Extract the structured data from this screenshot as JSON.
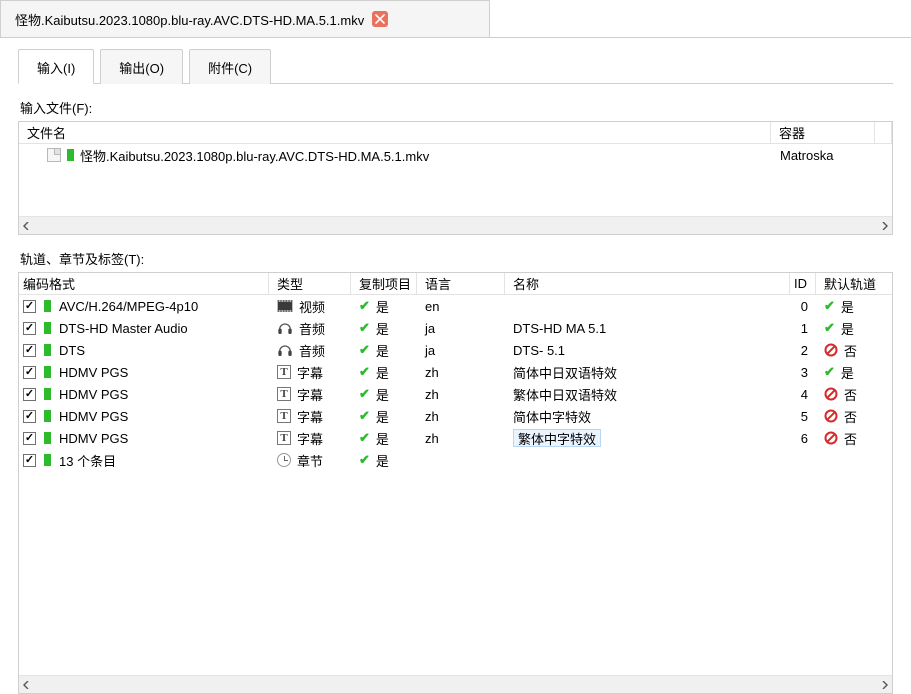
{
  "window_tab": {
    "title": "怪物.Kaibutsu.2023.1080p.blu-ray.AVC.DTS-HD.MA.5.1.mkv"
  },
  "inner_tabs": {
    "input": "输入(I)",
    "output": "输出(O)",
    "attach": "附件(C)"
  },
  "labels": {
    "input_files": "输入文件(F):",
    "tracks": "轨道、章节及标签(T):"
  },
  "file_table": {
    "headers": {
      "name": "文件名",
      "container": "容器"
    },
    "rows": [
      {
        "name": "怪物.Kaibutsu.2023.1080p.blu-ray.AVC.DTS-HD.MA.5.1.mkv",
        "container": "Matroska"
      }
    ]
  },
  "tracks_table": {
    "headers": {
      "codec": "编码格式",
      "type": "类型",
      "copy": "复制项目",
      "lang": "语言",
      "name": "名称",
      "id": "ID",
      "def": "默认轨道"
    },
    "type_labels": {
      "video": "视频",
      "audio": "音频",
      "subtitle": "字幕",
      "chapter": "章节"
    },
    "yes": "是",
    "no": "否",
    "rows": [
      {
        "codec": "AVC/H.264/MPEG-4p10",
        "type": "video",
        "copy": true,
        "lang": "en",
        "name": "",
        "id": "0",
        "def": true
      },
      {
        "codec": "DTS-HD Master Audio",
        "type": "audio",
        "copy": true,
        "lang": "ja",
        "name": "DTS-HD MA 5.1",
        "id": "1",
        "def": true
      },
      {
        "codec": "DTS",
        "type": "audio",
        "copy": true,
        "lang": "ja",
        "name": "DTS- 5.1",
        "id": "2",
        "def": false
      },
      {
        "codec": "HDMV PGS",
        "type": "subtitle",
        "copy": true,
        "lang": "zh",
        "name": "简体中日双语特效",
        "id": "3",
        "def": true
      },
      {
        "codec": "HDMV PGS",
        "type": "subtitle",
        "copy": true,
        "lang": "zh",
        "name": "繁体中日双语特效",
        "id": "4",
        "def": false
      },
      {
        "codec": "HDMV PGS",
        "type": "subtitle",
        "copy": true,
        "lang": "zh",
        "name": "简体中字特效",
        "id": "5",
        "def": false
      },
      {
        "codec": "HDMV PGS",
        "type": "subtitle",
        "copy": true,
        "lang": "zh",
        "name": "繁体中字特效",
        "id": "6",
        "def": false,
        "editing": true
      },
      {
        "codec": "13 个条目",
        "type": "chapter",
        "copy": true,
        "lang": "",
        "name": "",
        "id": "",
        "def": null
      }
    ]
  }
}
